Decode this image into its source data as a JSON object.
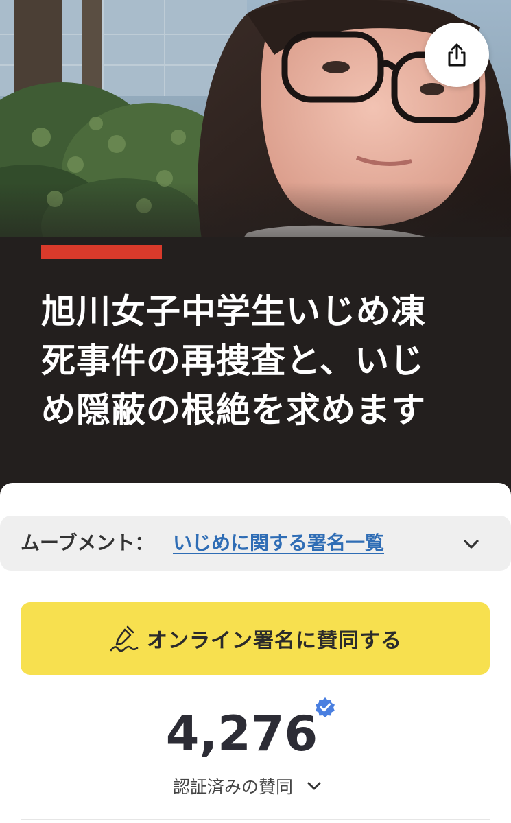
{
  "hero": {
    "image": "photo of a girl with glasses in front of shrubs"
  },
  "header": {
    "share_icon": "share-icon"
  },
  "petition": {
    "title_lines": [
      "旭川女子中学生いじめ凍",
      "死事件の再捜査と、いじ",
      "め隠蔽の根絶を求めます"
    ],
    "accent_color": "#d93a2b"
  },
  "movement": {
    "label": "ムーブメント：",
    "link_text": "いじめに関する署名一覧",
    "chevron_icon": "chevron-down-icon"
  },
  "sign_button": {
    "icon": "signature-pen-icon",
    "label": "オンライン署名に賛同する",
    "color": "#f7e04f"
  },
  "stats": {
    "count": "4,276",
    "verified_badge_icon": "verified-badge-icon",
    "verified_label": "認証済みの賛同",
    "chevron_icon": "chevron-down-icon",
    "badge_color": "#4a7fe0"
  }
}
